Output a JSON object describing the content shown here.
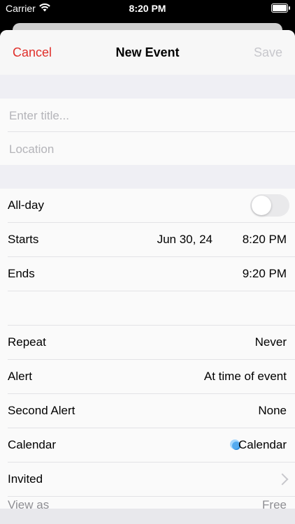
{
  "status_bar": {
    "carrier": "Carrier",
    "time": "8:20 PM"
  },
  "nav": {
    "cancel_label": "Cancel",
    "title": "New Event",
    "save_label": "Save"
  },
  "fields": {
    "title_placeholder": "Enter title...",
    "location_placeholder": "Location"
  },
  "all_day": {
    "label": "All-day",
    "enabled": false
  },
  "starts": {
    "label": "Starts",
    "date": "Jun 30, 24",
    "time": "8:20 PM"
  },
  "ends": {
    "label": "Ends",
    "time": "9:20 PM"
  },
  "options": {
    "repeat": {
      "label": "Repeat",
      "value": "Never"
    },
    "alert": {
      "label": "Alert",
      "value": "At time of event"
    },
    "second_alert": {
      "label": "Second Alert",
      "value": "None"
    },
    "calendar": {
      "label": "Calendar",
      "value": "Calendar",
      "color": "#2e8bd8"
    },
    "invited": {
      "label": "Invited"
    },
    "view_as": {
      "label": "View as",
      "value": "Free"
    }
  },
  "colors": {
    "accent": "#e0302b",
    "disabled": "#c7c7cc",
    "background": "#efeff4"
  }
}
